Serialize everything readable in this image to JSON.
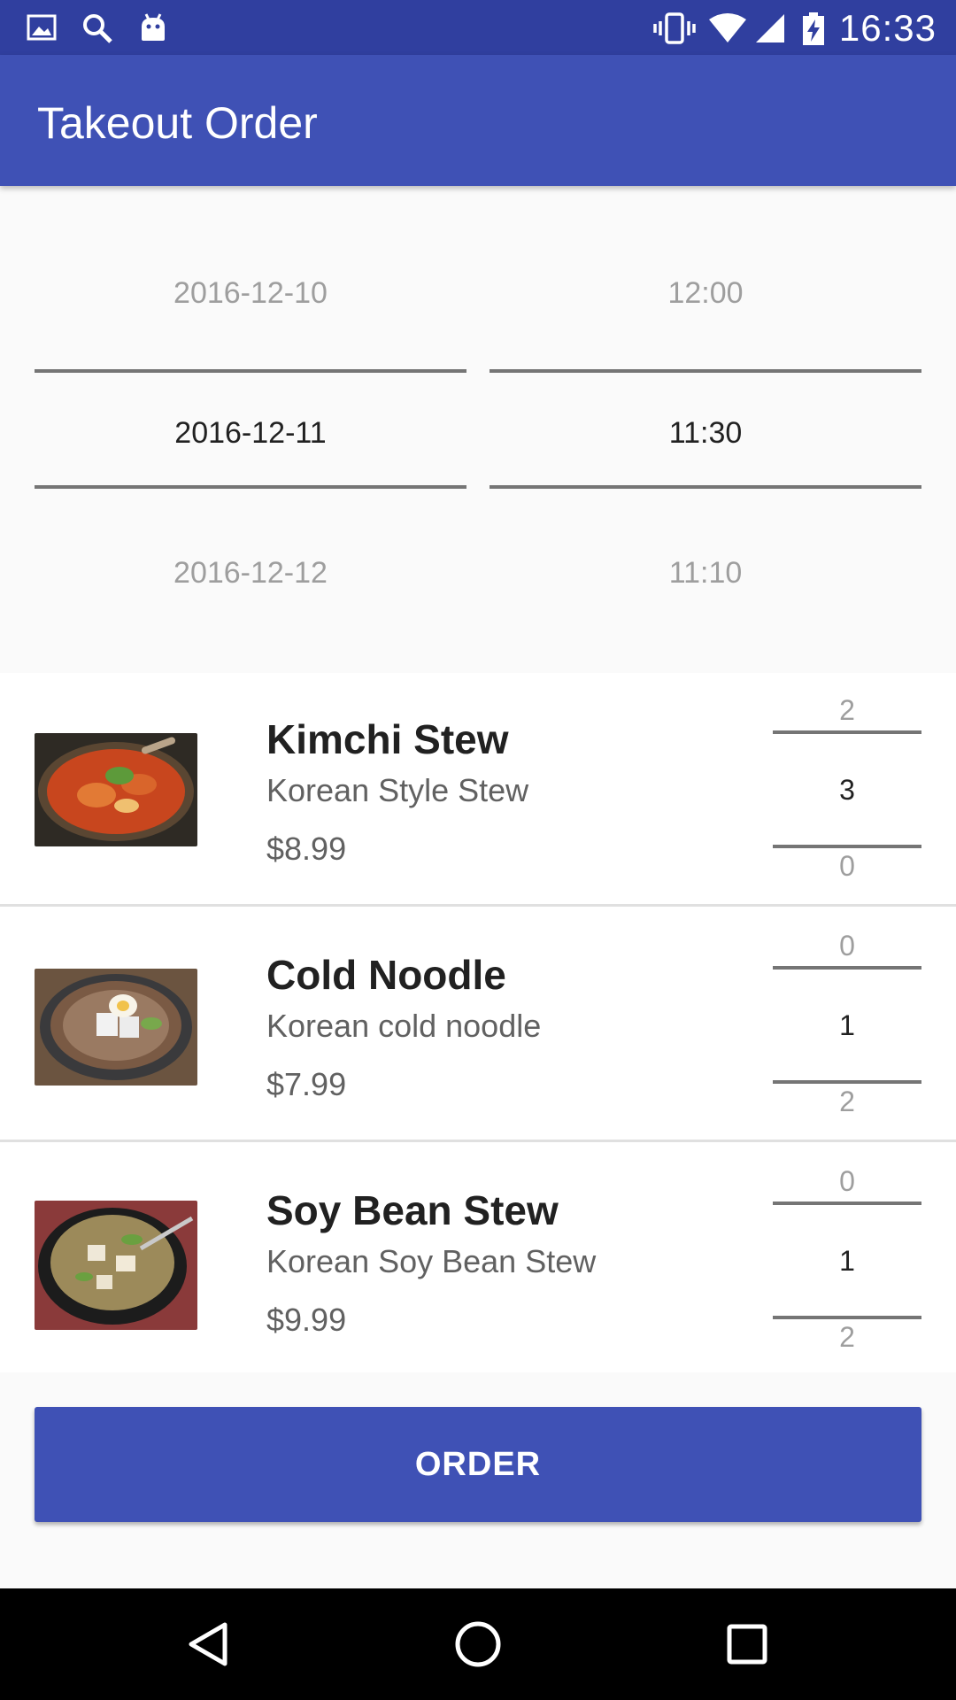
{
  "status_bar": {
    "time": "16:33",
    "left_icons": [
      "image-icon",
      "search-icon",
      "android-icon"
    ],
    "right_icons": [
      "vibrate-icon",
      "wifi-icon",
      "signal-icon",
      "battery-charging-icon"
    ]
  },
  "app_bar": {
    "title": "Takeout Order"
  },
  "date_picker": {
    "above": "2016-12-10",
    "selected": "2016-12-11",
    "below": "2016-12-12"
  },
  "time_picker": {
    "above": "12:00",
    "selected": "11:30",
    "below": "11:10"
  },
  "menu": {
    "items": [
      {
        "name": "Kimchi Stew",
        "description": "Korean Style Stew",
        "price": "$8.99",
        "qty_above": "2",
        "qty_selected": "3",
        "qty_below": "0"
      },
      {
        "name": "Cold Noodle",
        "description": "Korean cold noodle",
        "price": "$7.99",
        "qty_above": "0",
        "qty_selected": "1",
        "qty_below": "2"
      },
      {
        "name": "Soy Bean Stew",
        "description": "Korean Soy Bean Stew",
        "price": "$9.99",
        "qty_above": "0",
        "qty_selected": "1",
        "qty_below": "2"
      }
    ]
  },
  "order_button": {
    "label": "ORDER"
  },
  "nav_bar": {
    "icons": [
      "back-icon",
      "home-icon",
      "recents-icon"
    ]
  },
  "colors": {
    "primary": "#3f51b5",
    "primary_dark": "#303f9f"
  }
}
